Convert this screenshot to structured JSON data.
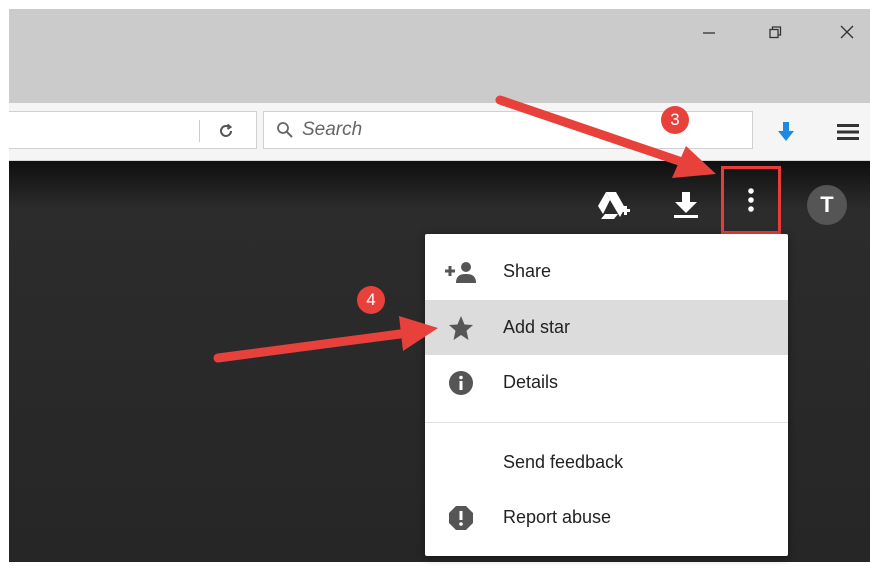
{
  "browser": {
    "window_controls": {
      "minimize_icon": "minimize-icon",
      "restore_icon": "restore-icon",
      "close_icon": "close-icon"
    },
    "search": {
      "placeholder": "Search",
      "value": ""
    },
    "toolbar_icons": [
      "reload-icon",
      "search-icon",
      "download-arrow-icon",
      "hamburger-menu-icon"
    ],
    "accent_color": "#1e88e5"
  },
  "viewer": {
    "header_icons": [
      "add-to-drive-icon",
      "download-icon",
      "more-vert-icon"
    ],
    "avatar_initial": "T"
  },
  "menu": {
    "items": [
      {
        "label": "Share",
        "icon": "person-add-icon"
      },
      {
        "label": "Add star",
        "icon": "star-icon",
        "highlighted": true
      },
      {
        "label": "Details",
        "icon": "info-icon"
      },
      {
        "label": "Send feedback",
        "icon": ""
      },
      {
        "label": "Report abuse",
        "icon": "report-icon"
      }
    ]
  },
  "annotations": {
    "step3": "3",
    "step4": "4",
    "color": "#e8403a"
  }
}
